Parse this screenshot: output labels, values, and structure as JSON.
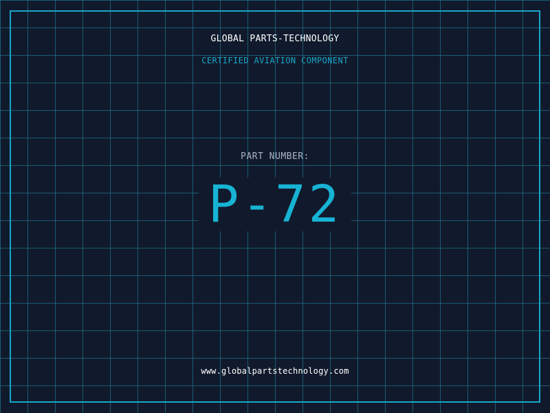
{
  "header": {
    "company_name": "GLOBAL PARTS-TECHNOLOGY",
    "subtitle": "CERTIFIED AVIATION COMPONENT"
  },
  "part": {
    "label": "PART NUMBER:",
    "number": "P-72"
  },
  "footer": {
    "website": "www.globalpartstechnology.com"
  },
  "colors": {
    "background": "#111a2c",
    "grid": "#1f708a",
    "frame": "#17a6c8",
    "accent": "#17b3d4",
    "label": "#a9b4c4",
    "text": "#ffffff"
  }
}
